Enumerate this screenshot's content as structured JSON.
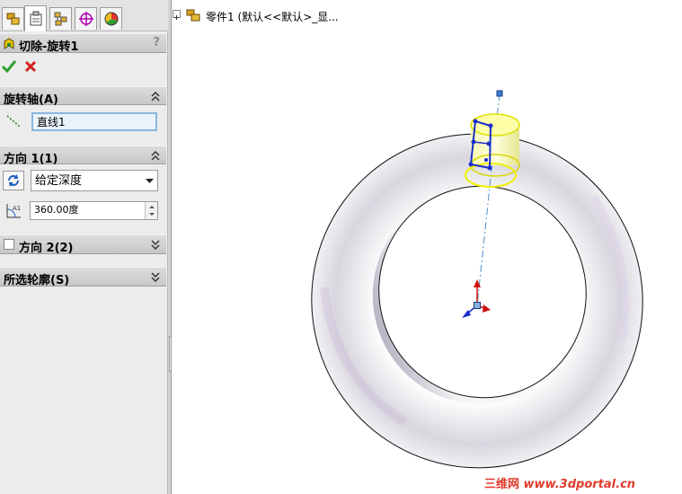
{
  "feature": {
    "title": "切除-旋转1",
    "help": "?"
  },
  "sections": {
    "axis": {
      "title": "旋转轴(A)",
      "value": "直线1"
    },
    "dir1": {
      "title": "方向 1(1)",
      "type": "给定深度",
      "angle": "360.00度"
    },
    "dir2": {
      "title": "方向 2(2)",
      "checked": false
    },
    "contours": {
      "title": "所选轮廓(S)"
    }
  },
  "tree": {
    "label": "零件1  (默认<<默认>_显..."
  },
  "watermark": {
    "cn": "三维网",
    "url": "www.3dportal.cn"
  },
  "colors": {
    "panel_bg": "#ececec",
    "ok_green": "#2f9e2f",
    "cancel_red": "#d42020",
    "selection_blue": "#1a2ecc",
    "highlight_yellow": "#f0f000"
  }
}
